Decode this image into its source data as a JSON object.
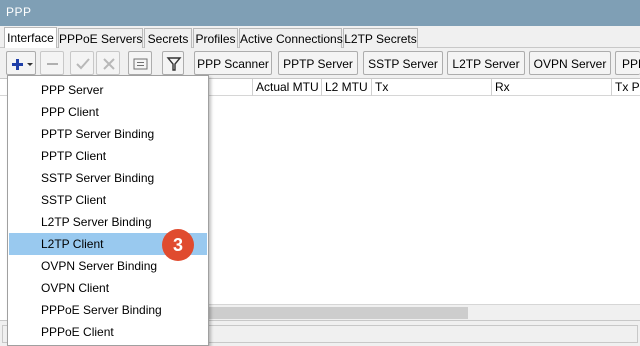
{
  "window": {
    "title": "PPP"
  },
  "tabs": [
    {
      "label": "Interface",
      "active": true
    },
    {
      "label": "PPPoE Servers"
    },
    {
      "label": "Secrets"
    },
    {
      "label": "Profiles"
    },
    {
      "label": "Active Connections"
    },
    {
      "label": "L2TP Secrets"
    }
  ],
  "toolbar": {
    "buttons": [
      {
        "label": "PPP Scanner"
      },
      {
        "label": "PPTP Server"
      },
      {
        "label": "SSTP Server"
      },
      {
        "label": "L2TP Server"
      },
      {
        "label": "OVPN Server"
      },
      {
        "label": "PPPoE Scan"
      }
    ]
  },
  "table": {
    "columns": [
      {
        "label": "Actual MTU"
      },
      {
        "label": "L2 MTU"
      },
      {
        "label": "Tx"
      },
      {
        "label": "Rx"
      },
      {
        "label": "Tx Packet (p/s)"
      }
    ]
  },
  "add_menu": {
    "items": [
      {
        "label": "PPP Server"
      },
      {
        "label": "PPP Client"
      },
      {
        "label": "PPTP Server Binding"
      },
      {
        "label": "PPTP Client"
      },
      {
        "label": "SSTP Server Binding"
      },
      {
        "label": "SSTP Client"
      },
      {
        "label": "L2TP Server Binding"
      },
      {
        "label": "L2TP Client",
        "highlighted": true
      },
      {
        "label": "OVPN Server Binding"
      },
      {
        "label": "OVPN Client"
      },
      {
        "label": "PPPoE Server Binding"
      },
      {
        "label": "PPPoE Client"
      }
    ]
  },
  "step_badge": {
    "number": "3"
  },
  "colors": {
    "title_bar": "#7f9fb5",
    "menu_highlight": "#99c9ef",
    "badge": "#e04b2f",
    "add_icon": "#1f3fa8"
  }
}
